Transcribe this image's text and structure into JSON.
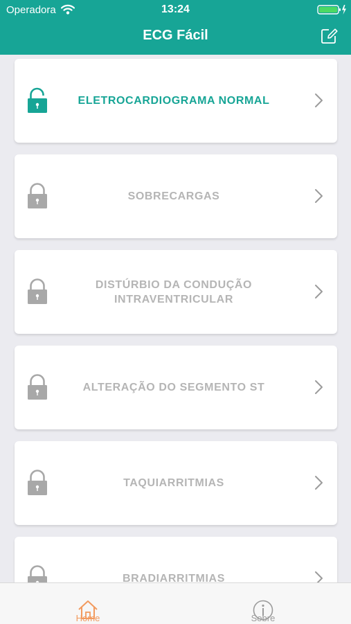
{
  "status_bar": {
    "carrier": "Operadora",
    "time": "13:24"
  },
  "nav": {
    "title": "ECG Fácil",
    "edit_icon": "compose-icon"
  },
  "items": [
    {
      "label": "ELETROCARDIOGRAMA NORMAL",
      "locked": false
    },
    {
      "label": "SOBRECARGAS",
      "locked": true
    },
    {
      "label": "DISTÚRBIO DA CONDUÇÃO INTRAVENTRICULAR",
      "locked": true
    },
    {
      "label": "ALTERAÇÃO DO SEGMENTO ST",
      "locked": true
    },
    {
      "label": "TAQUIARRITMIAS",
      "locked": true
    },
    {
      "label": "BRADIARRITMIAS",
      "locked": true
    }
  ],
  "tabbar": {
    "home_label": "Home",
    "about_label": "Sobre"
  },
  "colors": {
    "accent": "#17a596",
    "locked_text": "#b5b5b5",
    "active_tab": "#f29a5e",
    "background": "#ebebf0"
  }
}
